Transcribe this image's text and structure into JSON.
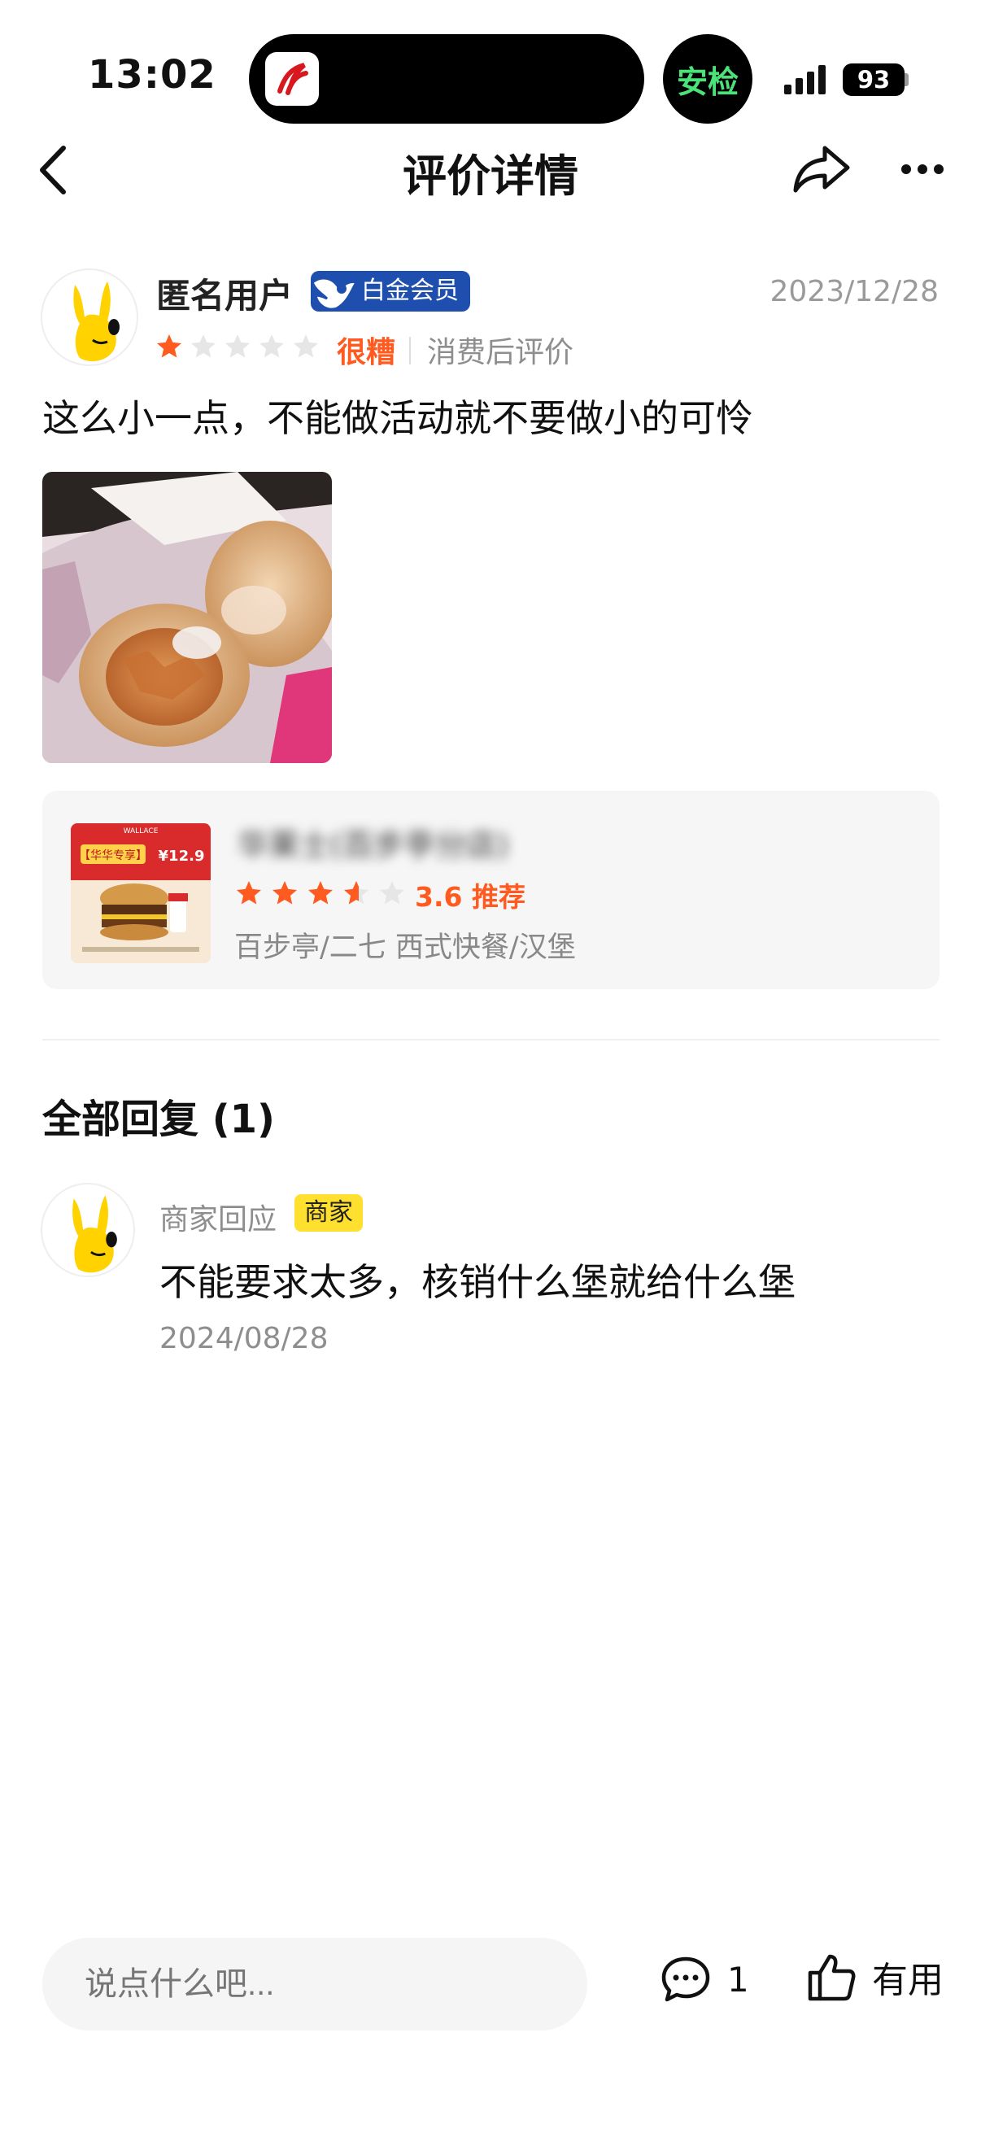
{
  "status_bar": {
    "time": "13:02",
    "security_label": "安检",
    "battery_level": "93"
  },
  "nav": {
    "title": "评价详情",
    "back_icon": "chevron-left-icon",
    "share_icon": "share-arrow-icon",
    "more_icon": "more-dots-icon"
  },
  "review": {
    "user_name": "匿名用户",
    "member_badge": "白金会员",
    "date": "2023/12/28",
    "rating": 1,
    "rating_max": 5,
    "rating_text": "很糟",
    "consumption_tag": "消费后评价",
    "text": "这么小一点，不能做活动就不要做小的可怜"
  },
  "shop": {
    "name": "华莱士(百步亭分店)",
    "rating": 3.6,
    "score_text": "3.6 推荐",
    "category": "百步亭/二七 西式快餐/汉堡",
    "promo_label": "【华华专享】",
    "promo_price": "¥12.9"
  },
  "replies": {
    "title": "全部回复 (1)",
    "items": [
      {
        "author": "商家回应",
        "badge": "商家",
        "text": "不能要求太多，核销什么堡就给什么堡",
        "date": "2024/08/28"
      }
    ]
  },
  "bottom_bar": {
    "input_placeholder": "说点什么吧...",
    "comment_count": "1",
    "useful_label": "有用"
  },
  "colors": {
    "accent_orange": "#ff5a1f",
    "member_blue": "#1f4fae",
    "merchant_yellow": "#ffe02e",
    "mascot_yellow": "#ffd200"
  }
}
